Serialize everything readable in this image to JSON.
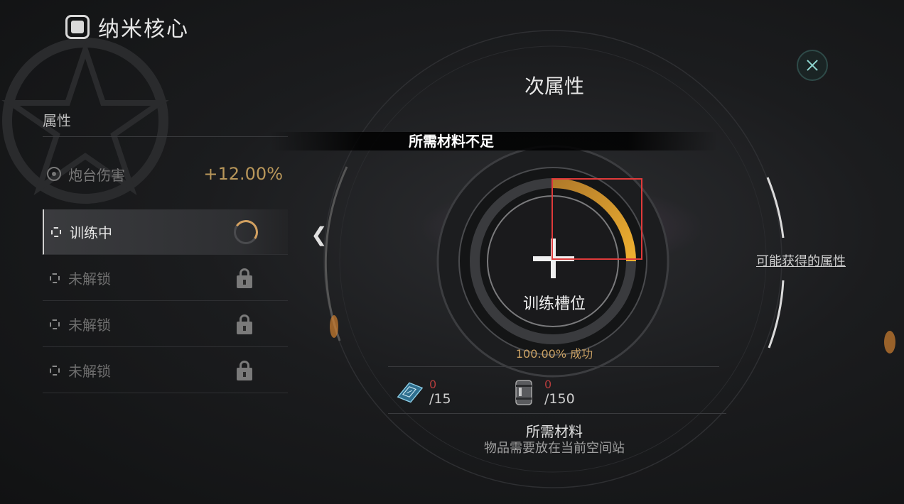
{
  "header": {
    "title": "纳米核心",
    "icon": "core-chip-icon"
  },
  "left_panel": {
    "section_label": "属性",
    "attribute": {
      "name": "炮台伤害",
      "value": "+12.00%"
    },
    "slots": [
      {
        "label": "训练中",
        "state": "training"
      },
      {
        "label": "未解锁",
        "state": "locked"
      },
      {
        "label": "未解锁",
        "state": "locked"
      },
      {
        "label": "未解锁",
        "state": "locked"
      }
    ]
  },
  "center": {
    "title": "次属性",
    "banner": "所需材料不足",
    "slot_label": "训练槽位",
    "success_rate": "100.00% 成功",
    "possible_attrs_link": "可能获得的属性"
  },
  "materials": {
    "items": [
      {
        "icon": "chip-board-icon",
        "have": "0",
        "need": "/15"
      },
      {
        "icon": "canister-icon",
        "have": "0",
        "need": "/150"
      }
    ],
    "title": "所需材料",
    "subtitle": "物品需要放在当前空间站"
  },
  "colors": {
    "accent_gold": "#c9a063",
    "warning_red": "#b43c3c",
    "highlight": "#e03a3a"
  }
}
